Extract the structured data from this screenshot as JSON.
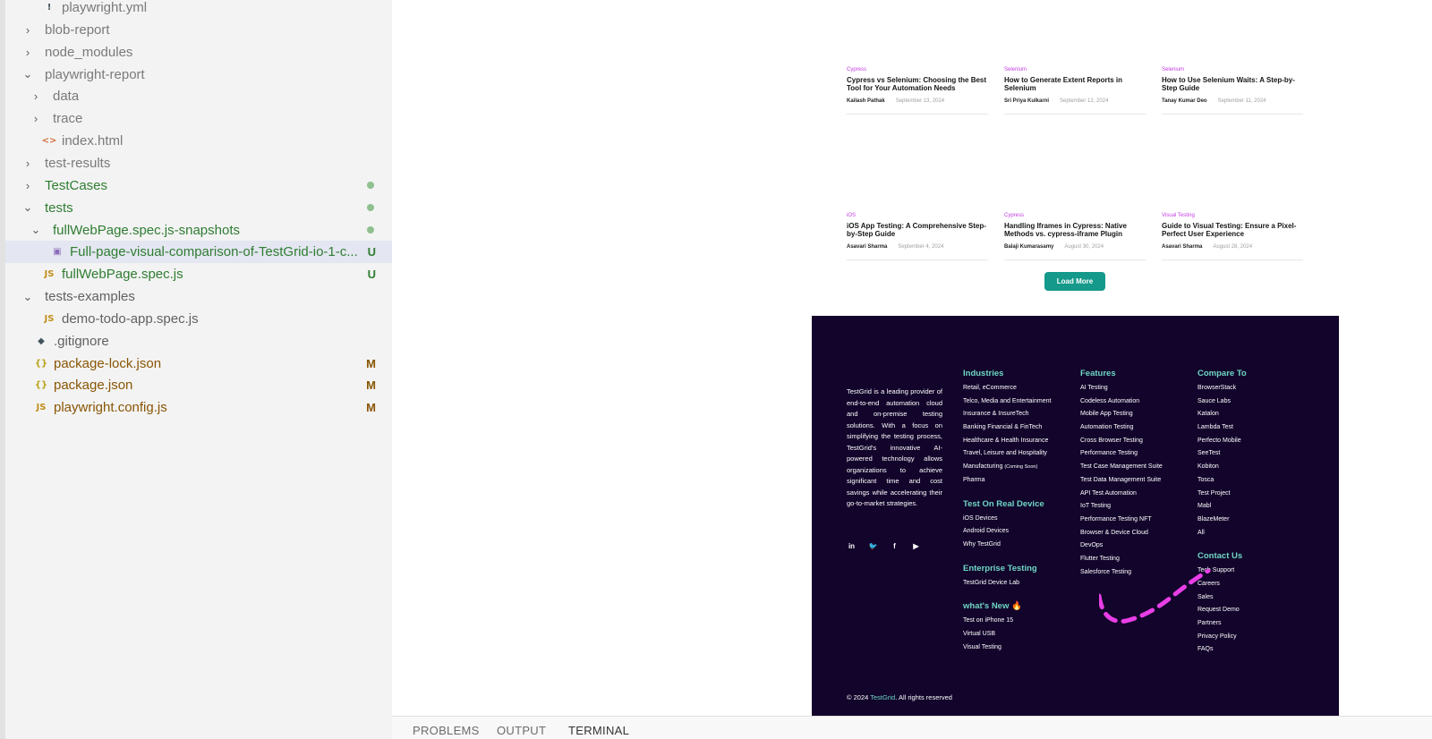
{
  "explorer": {
    "items": [
      {
        "label": "playwright.yml",
        "chev": "",
        "icon": "!",
        "icon_class": "ic-git",
        "indent": 1,
        "style": "c-dim"
      },
      {
        "label": "blob-report",
        "chev": "›",
        "icon": "",
        "indent": 0,
        "style": "c-dim"
      },
      {
        "label": "node_modules",
        "chev": "›",
        "icon": "",
        "indent": 0,
        "style": "c-dim"
      },
      {
        "label": "playwright-report",
        "chev": "⌄",
        "icon": "",
        "indent": 0,
        "style": "c-dim"
      },
      {
        "label": "data",
        "chev": "›",
        "icon": "",
        "indent": 1,
        "style": "c-dim"
      },
      {
        "label": "trace",
        "chev": "›",
        "icon": "",
        "indent": 1,
        "style": "c-dim"
      },
      {
        "label": "index.html",
        "chev": "",
        "icon": "<>",
        "icon_class": "ic-html",
        "indent": 1,
        "style": "c-dim"
      },
      {
        "label": "test-results",
        "chev": "›",
        "icon": "",
        "indent": 0,
        "style": "c-dim"
      },
      {
        "label": "TestCases",
        "chev": "›",
        "icon": "",
        "indent": 0,
        "style": "c-green",
        "dot": true
      },
      {
        "label": "tests",
        "chev": "⌄",
        "icon": "",
        "indent": 0,
        "style": "c-green",
        "dot": true
      },
      {
        "label": "fullWebPage.spec.js-snapshots",
        "chev": "⌄",
        "icon": "",
        "indent": 1,
        "style": "c-green",
        "dot": true
      },
      {
        "label": "Full-page-visual-comparison-of-TestGrid-io-1-c...",
        "chev": "",
        "icon": "▣",
        "icon_class": "ic-img",
        "indent": 2,
        "style": "c-green",
        "badge": "U",
        "selected": true
      },
      {
        "label": "fullWebPage.spec.js",
        "chev": "",
        "icon": "JS",
        "icon_class": "ic-js",
        "indent": 1,
        "style": "c-green",
        "badge": "U"
      },
      {
        "label": "tests-examples",
        "chev": "⌄",
        "icon": "",
        "indent": 0,
        "style": ""
      },
      {
        "label": "demo-todo-app.spec.js",
        "chev": "",
        "icon": "JS",
        "icon_class": "ic-js",
        "indent": 1,
        "style": ""
      },
      {
        "label": ".gitignore",
        "chev": "",
        "icon": "◆",
        "icon_class": "ic-git",
        "indent": 0,
        "style": ""
      },
      {
        "label": "package-lock.json",
        "chev": "",
        "icon": "{}",
        "icon_class": "ic-json",
        "indent": 0,
        "style": "c-mod",
        "badge": "M"
      },
      {
        "label": "package.json",
        "chev": "",
        "icon": "{}",
        "icon_class": "ic-json",
        "indent": 0,
        "style": "c-mod",
        "badge": "M"
      },
      {
        "label": "playwright.config.js",
        "chev": "",
        "icon": "JS",
        "icon_class": "ic-js",
        "indent": 0,
        "style": "c-mod",
        "badge": "M"
      }
    ]
  },
  "blog": {
    "articles": [
      {
        "category": "Cypress",
        "title": "Cypress vs Selenium: Choosing the Best Tool for Your Automation Needs",
        "author": "Kailash Pathak",
        "date": "September 13, 2024"
      },
      {
        "category": "Selenium",
        "title": "How to Generate Extent Reports in Selenium",
        "author": "Sri Priya Kulkarni",
        "date": "September 12, 2024"
      },
      {
        "category": "Selenium",
        "title": "How to Use Selenium Waits: A Step-by-Step Guide",
        "author": "Tanay Kumar Deo",
        "date": "September 11, 2024"
      },
      {
        "category": "iOS",
        "title": "iOS App Testing: A Comprehensive Step-by-Step Guide",
        "author": "Asavari Sharma",
        "date": "September 4, 2024"
      },
      {
        "category": "Cypress",
        "title": "Handling Iframes in Cypress: Native Methods vs. cypress-iframe Plugin",
        "author": "Balaji Kumarasamy",
        "date": "August 30, 2024"
      },
      {
        "category": "Visual Testing",
        "title": "Guide to Visual Testing: Ensure a Pixel-Perfect User Experience",
        "author": "Asavari Sharma",
        "date": "August 28, 2024"
      }
    ],
    "load_more": "Load More"
  },
  "footer": {
    "description": "TestGrid is a leading provider of end-to-end automation cloud and on-premise testing solutions. With a focus on simplifying the testing process, TestGrid's innovative AI-powered technology allows organizations to achieve significant time and cost savings while accelerating their go-to-market strategies.",
    "social": [
      {
        "icon": "linkedin-icon",
        "glyph": "in"
      },
      {
        "icon": "twitter-icon",
        "glyph": "🐦"
      },
      {
        "icon": "facebook-icon",
        "glyph": "f"
      },
      {
        "icon": "youtube-icon",
        "glyph": "▶"
      }
    ],
    "columns": [
      {
        "sections": [
          {
            "heading": "Industries",
            "items": [
              "Retail, eCommerce",
              "Telco, Media and Entertainment",
              "Insurance & InsureTech",
              "Banking Financial & FinTech",
              "Healthcare & Health Insurance",
              "Travel, Leisure and Hospitality",
              "Manufacturing",
              "Pharma"
            ]
          },
          {
            "heading": "Test On Real Device",
            "items": [
              "iOS Devices",
              "Android Devices",
              "Why TestGrid"
            ]
          },
          {
            "heading": "Enterprise Testing",
            "items": [
              "TestGrid Device Lab"
            ]
          },
          {
            "heading": "what's New 🔥",
            "items": [
              "Test on iPhone 15",
              "Virtual USB",
              "Visual Testing"
            ]
          }
        ]
      },
      {
        "sections": [
          {
            "heading": "Features",
            "items": [
              "AI Testing",
              "Codeless Automation",
              "Mobile App Testing",
              "Automation Testing",
              "Cross Browser Testing",
              "Performance Testing",
              "Test Case Management Suite",
              "Test Data Management Suite",
              "API Test Automation",
              "IoT Testing",
              "Performance Testing NFT",
              "Browser & Device Cloud",
              "DevOps",
              "Flutter Testing",
              "Salesforce Testing"
            ]
          }
        ]
      },
      {
        "sections": [
          {
            "heading": "Compare To",
            "items": [
              "BrowserStack",
              "Sauce Labs",
              "Katalon",
              "Lambda Test",
              "Perfecto Mobile",
              "SeeTest",
              "Kobiton",
              "Tosca",
              "Test Project",
              "Mabl",
              "BlazeMeter",
              "All"
            ]
          },
          {
            "heading": "Contact Us",
            "items": [
              "Tech Support",
              "Careers",
              "Sales",
              "Request Demo",
              "Partners",
              "Privacy Policy",
              "FAQs"
            ]
          }
        ]
      }
    ],
    "coming_soon": "(Coming Soon)",
    "copyright_prefix": "© 2024 ",
    "copyright_brand": "TestGrid",
    "copyright_suffix": ". All rights reserved"
  },
  "panel": {
    "tabs": [
      "PROBLEMS",
      "OUTPUT",
      "TERMINAL"
    ],
    "active": "TERMINAL"
  },
  "colors": {
    "accent": "#14998a",
    "footer_bg": "#12042b",
    "footer_heading": "#6fd6c4",
    "category": "#c23de0",
    "cursor_trail": "#e83ee6"
  }
}
